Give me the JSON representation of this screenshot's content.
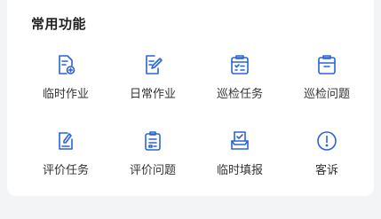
{
  "section": {
    "title": "常用功能"
  },
  "accent_color": "#2b63d6",
  "functions": [
    {
      "label": "临时作业",
      "icon": "document-add-icon"
    },
    {
      "label": "日常作业",
      "icon": "document-edit-icon"
    },
    {
      "label": "巡检任务",
      "icon": "inspection-list-icon"
    },
    {
      "label": "巡检问题",
      "icon": "inspection-box-icon"
    },
    {
      "label": "评价任务",
      "icon": "evaluate-edit-icon"
    },
    {
      "label": "评价问题",
      "icon": "clipboard-list-icon"
    },
    {
      "label": "临时填报",
      "icon": "report-check-icon"
    },
    {
      "label": "客诉",
      "icon": "alert-circle-icon"
    }
  ]
}
